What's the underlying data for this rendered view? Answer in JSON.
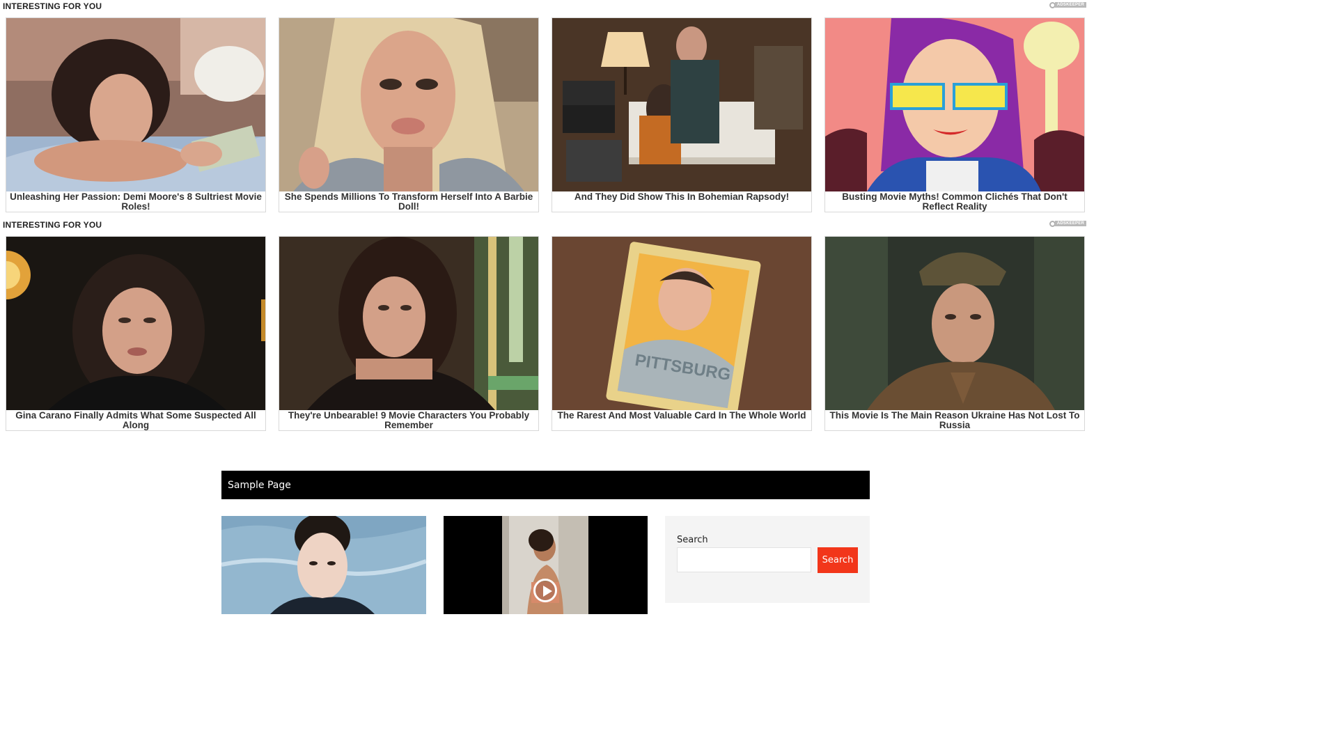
{
  "widget": {
    "title": "INTERESTING FOR YOU",
    "brand": "ADSKEEPER"
  },
  "rows": [
    {
      "cards": [
        {
          "caption": "Unleashing Her Passion: Demi Moore's 8 Sultriest Movie Roles!"
        },
        {
          "caption": "She Spends Millions To Transform Herself Into A Barbie Doll!"
        },
        {
          "caption": "And They Did Show This In Bohemian Rapsody!"
        },
        {
          "caption": "Busting Movie Myths! Common Clichés That Don't Reflect Reality"
        }
      ]
    },
    {
      "cards": [
        {
          "caption": "Gina Carano Finally Admits What Some Suspected All Along"
        },
        {
          "caption": "They're Unbearable! 9 Movie Characters You Probably Remember"
        },
        {
          "caption": "The Rarest And Most Valuable Card In The Whole World"
        },
        {
          "caption": "This Movie Is The Main Reason Ukraine Has Not Lost To Russia"
        }
      ]
    }
  ],
  "card_image_text": {
    "baseball_card": "PITTSBURG"
  },
  "nav": {
    "link": "Sample Page"
  },
  "sidebar": {
    "search_label": "Search",
    "search_value": "",
    "search_button": "Search"
  },
  "colors": {
    "nav_bg": "#000000",
    "search_button": "#f2361a",
    "sidebar_bg": "#f4f4f4"
  }
}
